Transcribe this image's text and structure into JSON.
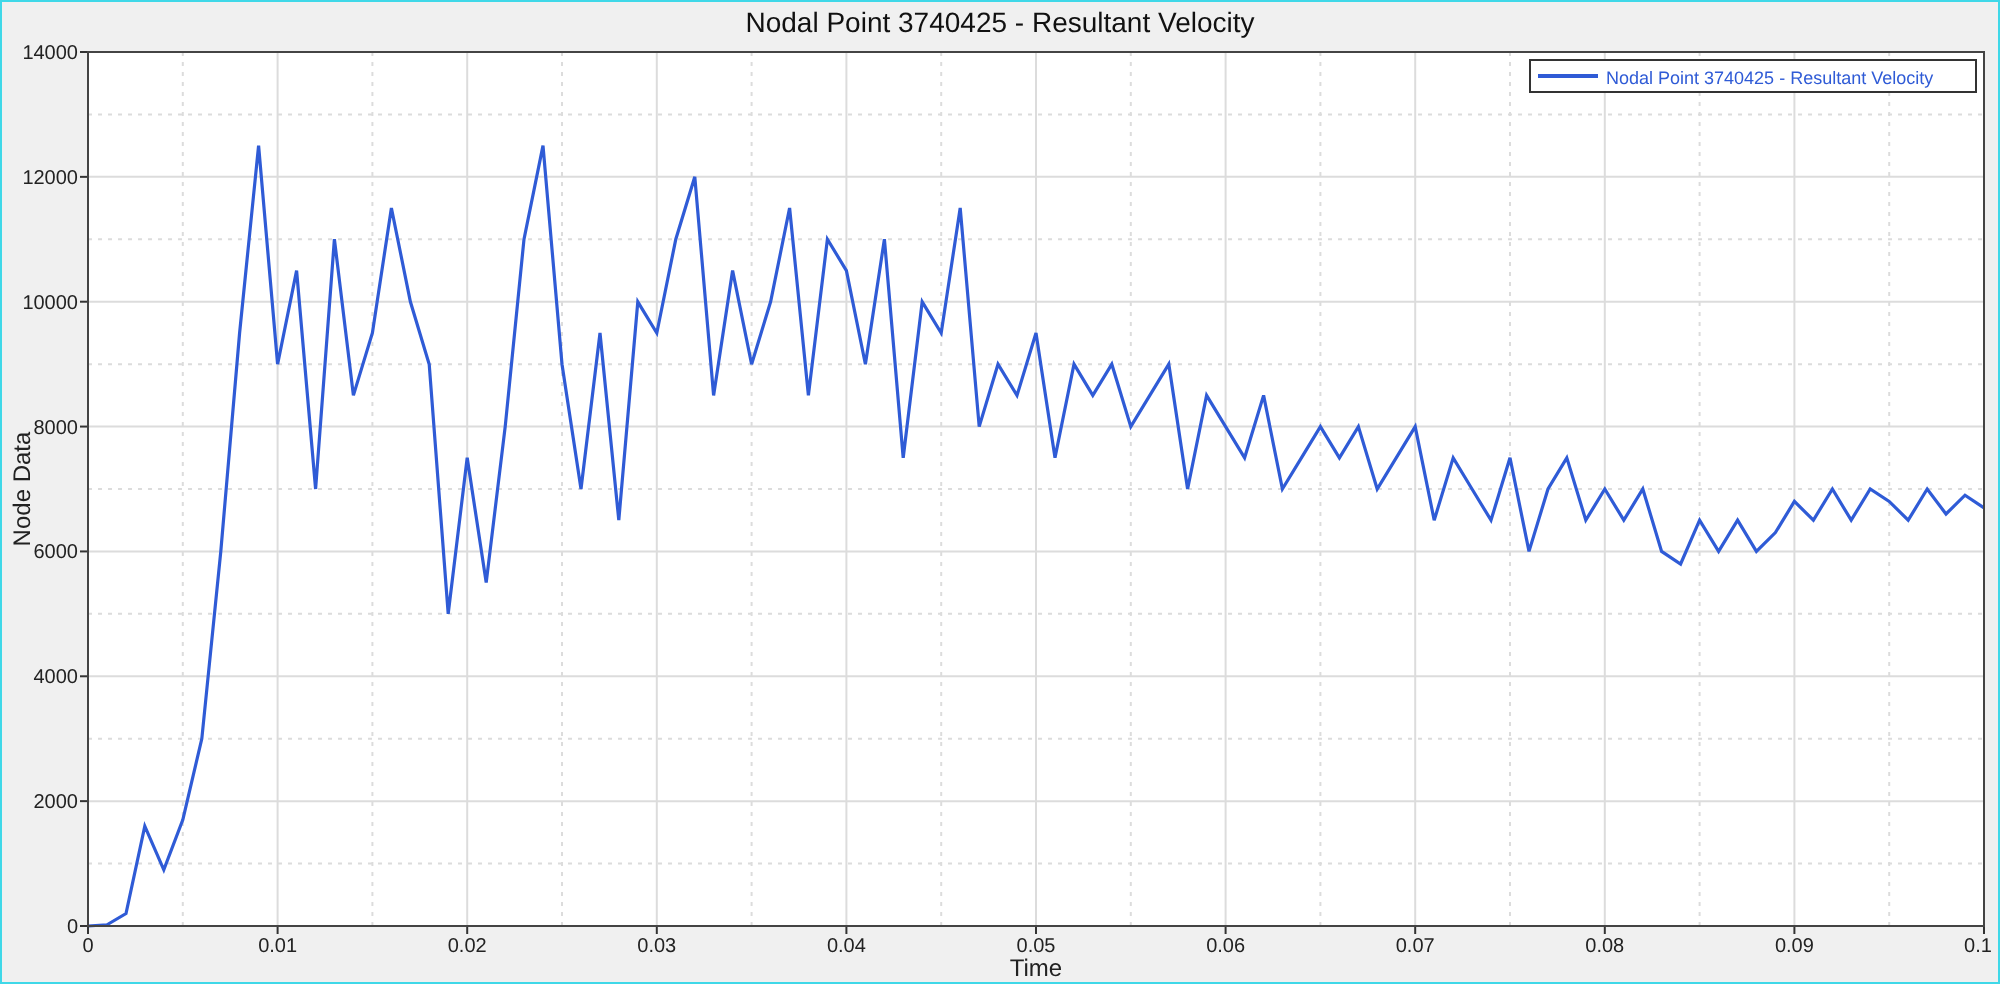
{
  "chart": {
    "chart_data": {
      "type": "line",
      "grid": true,
      "title": "Nodal Point 3740425 - Resultant Velocity",
      "xlabel": "Time",
      "ylabel": "Node Data",
      "xlim": [
        0,
        0.1
      ],
      "ylim": [
        0,
        14000
      ],
      "xticks": [
        {
          "value": 0,
          "label": "0"
        },
        {
          "value": 0.01,
          "label": "0.01"
        },
        {
          "value": 0.02,
          "label": "0.02"
        },
        {
          "value": 0.03,
          "label": "0.03"
        },
        {
          "value": 0.04,
          "label": "0.04"
        },
        {
          "value": 0.05,
          "label": "0.05"
        },
        {
          "value": 0.06,
          "label": "0.06"
        },
        {
          "value": 0.07,
          "label": "0.07"
        },
        {
          "value": 0.08,
          "label": "0.08"
        },
        {
          "value": 0.09,
          "label": "0.09"
        },
        {
          "value": 0.1,
          "label": "0.1"
        }
      ],
      "yticks": [
        0,
        2000,
        4000,
        6000,
        8000,
        10000,
        12000,
        14000
      ],
      "x": [
        0,
        0.001,
        0.002,
        0.003,
        0.004,
        0.005,
        0.006,
        0.007,
        0.008,
        0.009,
        0.01,
        0.011,
        0.012,
        0.013,
        0.014,
        0.015,
        0.016,
        0.017,
        0.018,
        0.019,
        0.02,
        0.021,
        0.022,
        0.023,
        0.024,
        0.025,
        0.026,
        0.027,
        0.028,
        0.029,
        0.03,
        0.031,
        0.032,
        0.033,
        0.034,
        0.035,
        0.036,
        0.037,
        0.038,
        0.039,
        0.04,
        0.041,
        0.042,
        0.043,
        0.044,
        0.045,
        0.046,
        0.047,
        0.048,
        0.049,
        0.05,
        0.051,
        0.052,
        0.053,
        0.054,
        0.055,
        0.056,
        0.057,
        0.058,
        0.059,
        0.06,
        0.061,
        0.062,
        0.063,
        0.064,
        0.065,
        0.066,
        0.067,
        0.068,
        0.069,
        0.07,
        0.071,
        0.072,
        0.073,
        0.074,
        0.075,
        0.076,
        0.077,
        0.078,
        0.079,
        0.08,
        0.081,
        0.082,
        0.083,
        0.084,
        0.085,
        0.086,
        0.087,
        0.088,
        0.089,
        0.09,
        0.091,
        0.092,
        0.093,
        0.094,
        0.095,
        0.096,
        0.097,
        0.098,
        0.099,
        0.1
      ],
      "series": [
        {
          "name": "Nodal Point 3740425 - Resultant Velocity",
          "color": "#2f5bd6",
          "values": [
            0,
            20,
            200,
            1600,
            900,
            1700,
            3000,
            6000,
            9500,
            12500,
            9000,
            10500,
            7000,
            11000,
            8500,
            9500,
            11500,
            10000,
            9000,
            5000,
            7500,
            5500,
            8000,
            11000,
            12500,
            9000,
            7000,
            9500,
            6500,
            10000,
            9500,
            11000,
            12000,
            8500,
            10500,
            9000,
            10000,
            11500,
            8500,
            11000,
            10500,
            9000,
            11000,
            7500,
            10000,
            9500,
            11500,
            8000,
            9000,
            8500,
            9500,
            7500,
            9000,
            8500,
            9000,
            8000,
            8500,
            9000,
            7000,
            8500,
            8000,
            7500,
            8500,
            7000,
            7500,
            8000,
            7500,
            8000,
            7000,
            7500,
            8000,
            6500,
            7500,
            7000,
            6500,
            7500,
            6000,
            7000,
            7500,
            6500,
            7000,
            6500,
            7000,
            6000,
            5800,
            6500,
            6000,
            6500,
            6000,
            6300,
            6800,
            6500,
            7000,
            6500,
            7000,
            6800,
            6500,
            7000,
            6600,
            6900,
            6700
          ]
        }
      ]
    }
  }
}
